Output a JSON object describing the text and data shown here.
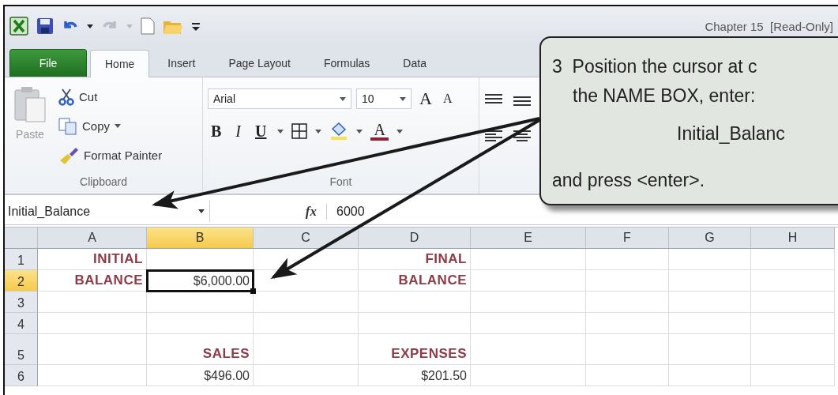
{
  "window": {
    "title": "Chapter 15  [Read-Only]"
  },
  "tabs": [
    {
      "label": "File",
      "kind": "file",
      "selected": false
    },
    {
      "label": "Home",
      "kind": "tab",
      "selected": true
    },
    {
      "label": "Insert",
      "kind": "tab",
      "selected": false
    },
    {
      "label": "Page Layout",
      "kind": "tab",
      "selected": false
    },
    {
      "label": "Formulas",
      "kind": "tab",
      "selected": false
    },
    {
      "label": "Data",
      "kind": "tab",
      "selected": false
    }
  ],
  "ribbon": {
    "clipboard": {
      "paste": "Paste",
      "cut": "Cut",
      "copy": "Copy",
      "format_painter": "Format Painter",
      "label": "Clipboard"
    },
    "font": {
      "font_name": "Arial",
      "font_size": "10",
      "grow_font": "A",
      "shrink_font": "A",
      "bold": "B",
      "italic": "I",
      "underline": "U",
      "font_color": "A",
      "label": "Font"
    }
  },
  "formula_bar": {
    "name_box": "Initial_Balance",
    "fx": "fx",
    "value": "6000"
  },
  "sheet": {
    "columns": [
      {
        "label": "A",
        "selected": false
      },
      {
        "label": "B",
        "selected": true
      },
      {
        "label": "C",
        "selected": false
      },
      {
        "label": "D",
        "selected": false
      },
      {
        "label": "E",
        "selected": false
      },
      {
        "label": "F",
        "selected": false
      },
      {
        "label": "G",
        "selected": false
      },
      {
        "label": "H",
        "selected": false
      }
    ],
    "rows": [
      {
        "header": "1",
        "selected": false,
        "tall": false,
        "cells": [
          {
            "kind": "label",
            "text": "INITIAL",
            "selected": false
          },
          {
            "kind": "blank",
            "selected": false
          },
          {
            "kind": "blank",
            "selected": false
          },
          {
            "kind": "label",
            "text": "FINAL",
            "selected": false
          },
          {
            "kind": "blank",
            "selected": false
          },
          {
            "kind": "blank",
            "selected": false
          },
          {
            "kind": "blank",
            "selected": false
          },
          {
            "kind": "blank",
            "selected": false
          }
        ]
      },
      {
        "header": "2",
        "selected": true,
        "tall": false,
        "cells": [
          {
            "kind": "label",
            "text": "BALANCE",
            "selected": false
          },
          {
            "kind": "amount",
            "text": "$6,000.00",
            "selected": true
          },
          {
            "kind": "blank",
            "selected": false
          },
          {
            "kind": "label",
            "text": "BALANCE",
            "selected": false
          },
          {
            "kind": "blank",
            "selected": false
          },
          {
            "kind": "blank",
            "selected": false
          },
          {
            "kind": "blank",
            "selected": false
          },
          {
            "kind": "blank",
            "selected": false
          }
        ]
      },
      {
        "header": "3",
        "selected": false,
        "tall": false,
        "cells": [
          {
            "kind": "blank",
            "selected": false
          },
          {
            "kind": "blank",
            "selected": false
          },
          {
            "kind": "blank",
            "selected": false
          },
          {
            "kind": "blank",
            "selected": false
          },
          {
            "kind": "blank",
            "selected": false
          },
          {
            "kind": "blank",
            "selected": false
          },
          {
            "kind": "blank",
            "selected": false
          },
          {
            "kind": "blank",
            "selected": false
          }
        ]
      },
      {
        "header": "4",
        "selected": false,
        "tall": false,
        "cells": [
          {
            "kind": "blank",
            "selected": false
          },
          {
            "kind": "blank",
            "selected": false
          },
          {
            "kind": "blank",
            "selected": false
          },
          {
            "kind": "blank",
            "selected": false
          },
          {
            "kind": "blank",
            "selected": false
          },
          {
            "kind": "blank",
            "selected": false
          },
          {
            "kind": "blank",
            "selected": false
          },
          {
            "kind": "blank",
            "selected": false
          }
        ]
      },
      {
        "header": "5",
        "selected": false,
        "tall": true,
        "cells": [
          {
            "kind": "blank",
            "selected": false
          },
          {
            "kind": "label",
            "text": "SALES",
            "selected": false
          },
          {
            "kind": "blank",
            "selected": false
          },
          {
            "kind": "label",
            "text": "EXPENSES",
            "selected": false
          },
          {
            "kind": "blank",
            "selected": false
          },
          {
            "kind": "blank",
            "selected": false
          },
          {
            "kind": "blank",
            "selected": false
          },
          {
            "kind": "blank",
            "selected": false
          }
        ]
      },
      {
        "header": "6",
        "selected": false,
        "tall": false,
        "cells": [
          {
            "kind": "blank",
            "selected": false
          },
          {
            "kind": "amount",
            "text": "$496.00",
            "selected": false
          },
          {
            "kind": "blank",
            "selected": false
          },
          {
            "kind": "amount",
            "text": "$201.50",
            "selected": false
          },
          {
            "kind": "blank",
            "selected": false
          },
          {
            "kind": "blank",
            "selected": false
          },
          {
            "kind": "blank",
            "selected": false
          },
          {
            "kind": "blank",
            "selected": false
          }
        ]
      }
    ]
  },
  "callout": {
    "lines": [
      {
        "kind": "step",
        "number": "3",
        "text": "Position the cursor at c"
      },
      {
        "kind": "text",
        "text": "the NAME BOX, enter:"
      },
      {
        "kind": "indented",
        "text": "Initial_Balanc"
      },
      {
        "kind": "text",
        "text": "and press <enter>."
      }
    ]
  }
}
